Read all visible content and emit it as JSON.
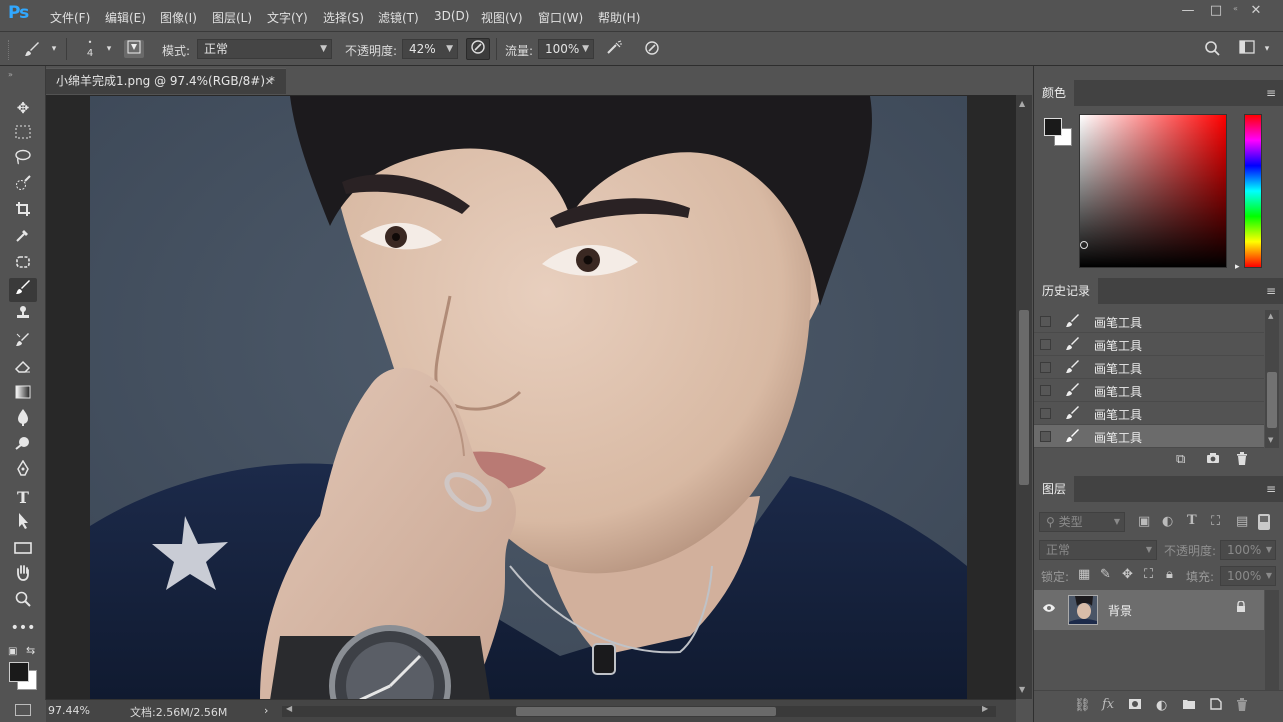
{
  "app": {
    "logo": "Ps"
  },
  "menu": [
    "文件(F)",
    "编辑(E)",
    "图像(I)",
    "图层(L)",
    "文字(Y)",
    "选择(S)",
    "滤镜(T)",
    "3D(D)",
    "视图(V)",
    "窗口(W)",
    "帮助(H)"
  ],
  "window_controls": {
    "minimize": "—",
    "maximize": "□",
    "close": "✕"
  },
  "options": {
    "brush_size": "4",
    "mode_label": "模式:",
    "mode_value": "正常",
    "opacity_label": "不透明度:",
    "opacity_value": "42%",
    "flow_label": "流量:",
    "flow_value": "100%"
  },
  "document": {
    "tab_title": "小绵羊完成1.png @ 97.4%(RGB/8#) *",
    "zoom": "97.44%",
    "doc_size": "文档:2.56M/2.56M"
  },
  "panels": {
    "color": {
      "title": "颜色"
    },
    "history": {
      "title": "历史记录",
      "items": [
        "画笔工具",
        "画笔工具",
        "画笔工具",
        "画笔工具",
        "画笔工具",
        "画笔工具"
      ]
    },
    "layers": {
      "title": "图层",
      "filter_placeholder": "类型",
      "blend_mode": "正常",
      "opacity_label": "不透明度:",
      "opacity_value": "100%",
      "lock_label": "锁定:",
      "fill_label": "填充:",
      "fill_value": "100%",
      "layer_name": "背景"
    }
  },
  "colors": {
    "accent": "#31a8ff",
    "foreground": "#1a1a1a",
    "background": "#ffffff",
    "picker_hue": "#ff0000"
  }
}
